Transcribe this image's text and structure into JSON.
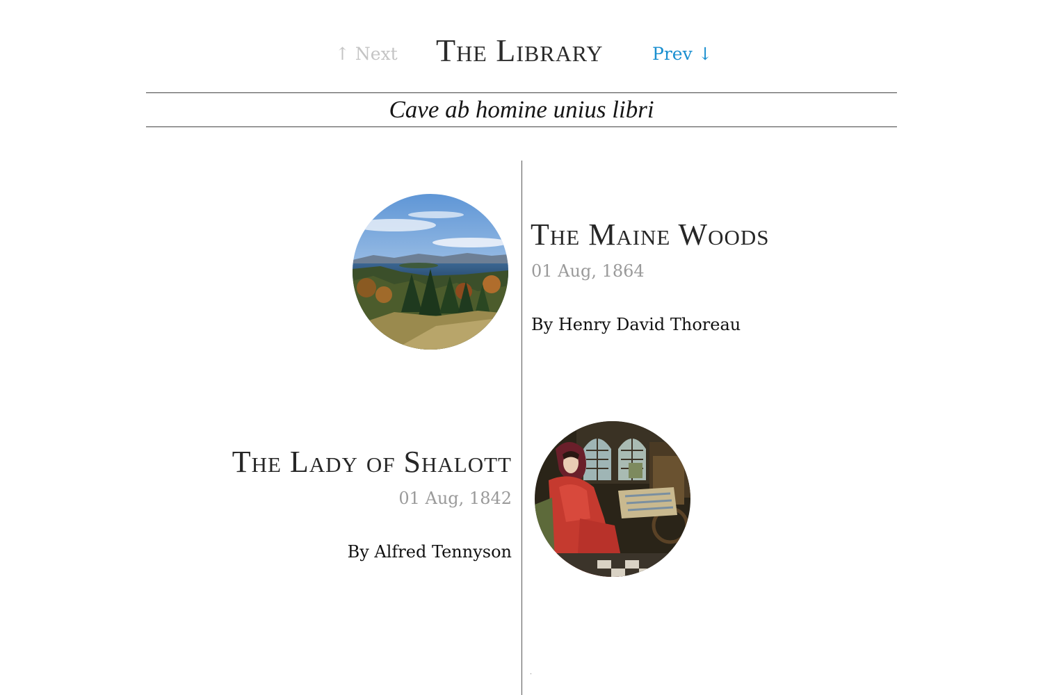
{
  "header": {
    "next_label": "↑ Next",
    "title": "The Library",
    "prev_label": "Prev ↓"
  },
  "tagline": "Cave ab homine unius libri",
  "entries": [
    {
      "title": "The Maine Woods",
      "date": "01 Aug, 1864",
      "author": "By Henry David Thoreau",
      "thumbnail": "lake-forest-landscape"
    },
    {
      "title": "The Lady of Shalott",
      "date": "01 Aug, 1842",
      "author": "By Alfred Tennyson",
      "thumbnail": "lady-at-loom-painting"
    }
  ],
  "colors": {
    "link": "#1a8fd0",
    "disabled": "#c4c4c4",
    "date": "#9a9a9a",
    "rule": "#444444"
  }
}
